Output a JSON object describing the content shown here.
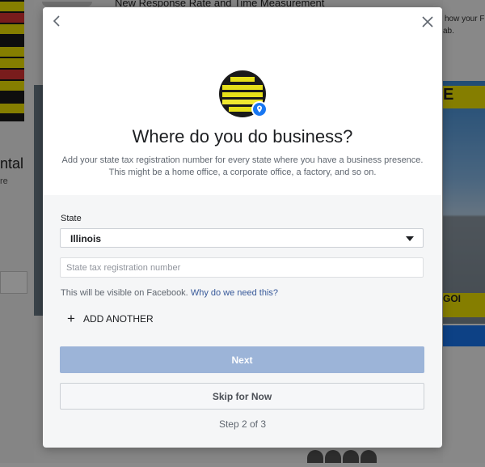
{
  "background": {
    "top_title": "New Response Rate and Time Measurement",
    "right_text_line1": "how your F",
    "right_text_line2": "ab.",
    "left_text_big": "ntal",
    "left_text_small": "re",
    "banner_sign": "E",
    "banner_sign_bottom": "GOI"
  },
  "modal": {
    "back_icon": "chevron-left-icon",
    "close_icon": "close-icon",
    "title": "Where do you do business?",
    "subtitle_line1": "Add your state tax registration number for every state where you have a business presence.",
    "subtitle_line2": "This might be a home office, a corporate office, a factory, and so on.",
    "state_label": "State",
    "state_value": "Illinois",
    "tax_placeholder": "State tax registration number",
    "visible_note": "This will be visible on Facebook.",
    "why_link": "Why do we need this?",
    "add_another_label": "ADD ANOTHER",
    "next_label": "Next",
    "skip_label": "Skip for Now",
    "step_text": "Step 2 of 3"
  },
  "colors": {
    "accent": "#1877f2",
    "next_disabled": "#9cb4d8",
    "link": "#365899"
  }
}
